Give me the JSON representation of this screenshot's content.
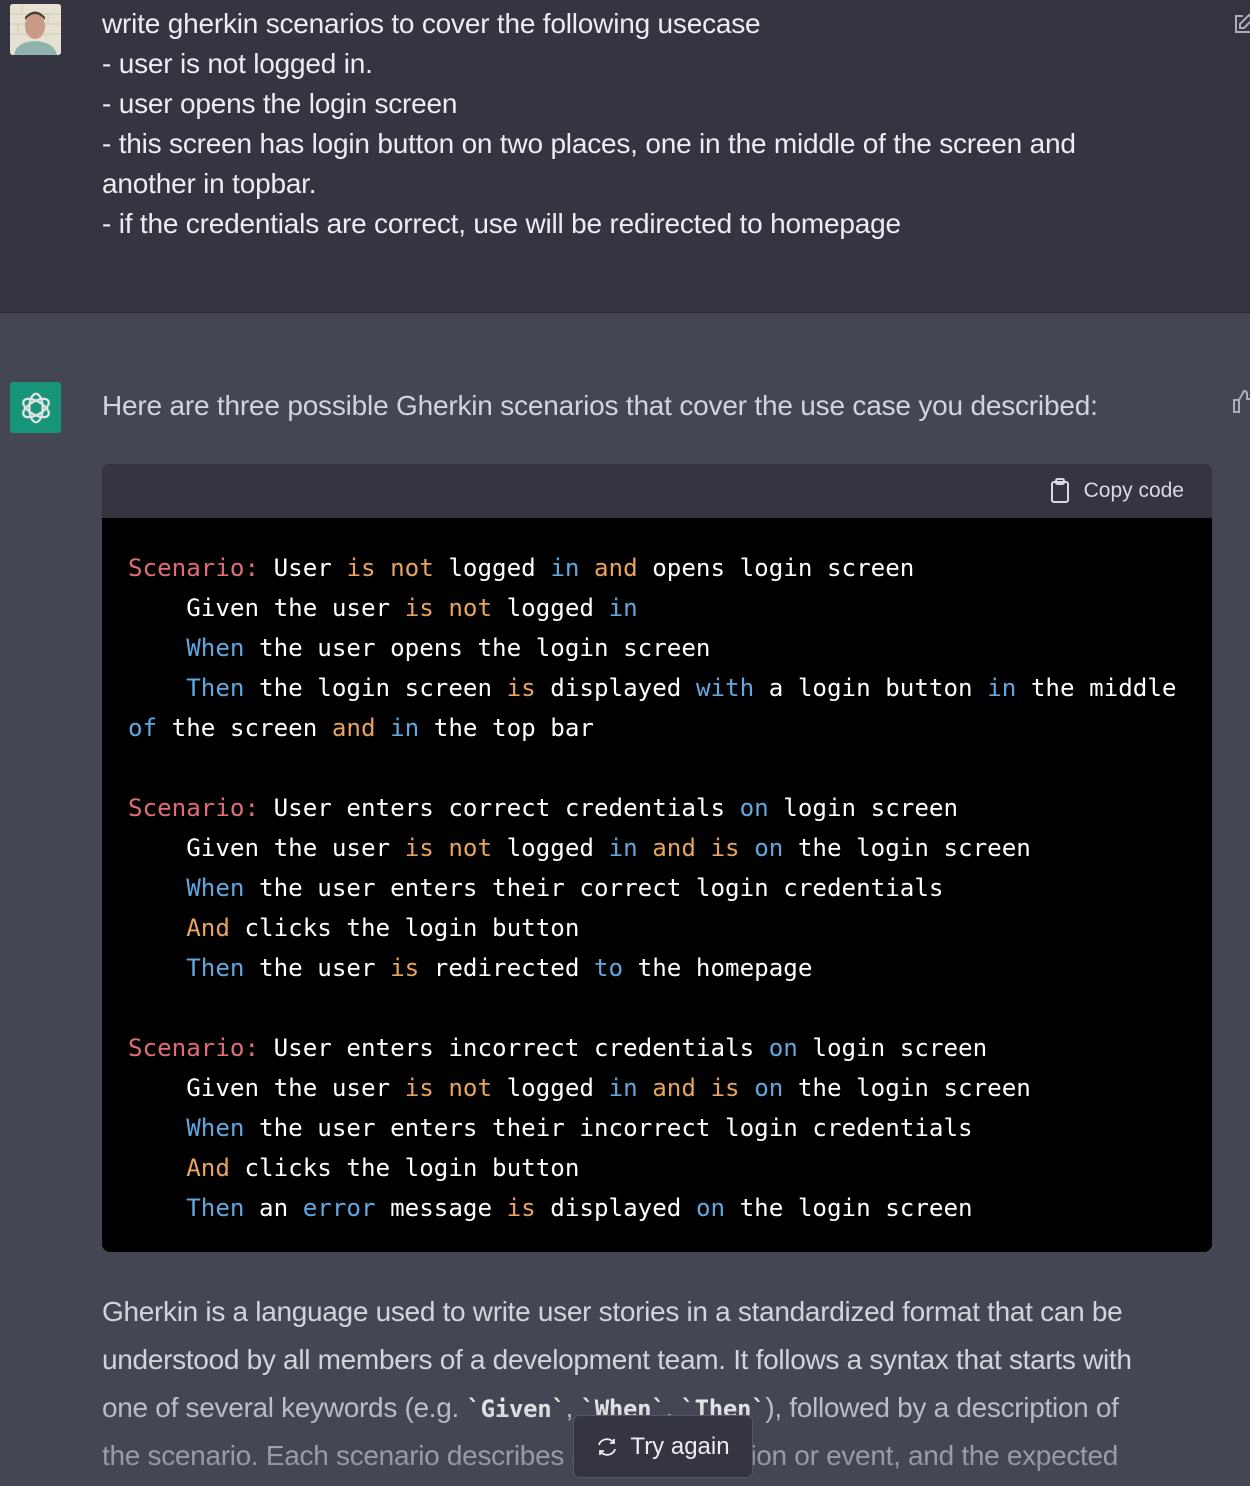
{
  "user_turn": {
    "avatar": "user-avatar-photo",
    "message_lines": [
      "write gherkin scenarios to cover the following usecase",
      "- user is not logged in.",
      "- user opens the login screen",
      "- this screen has login button on two places, one in the middle of the screen and",
      "another in topbar.",
      "- if the credentials are correct, use will be redirected to homepage"
    ],
    "edit_icon": "edit-icon"
  },
  "assistant_turn": {
    "avatar": "openai-logo",
    "intro": "Here are three possible Gherkin scenarios that cover the use case you described:",
    "feedback_icon": "thumbs-up-icon",
    "code_block": {
      "copy_label": "Copy code",
      "copy_icon": "clipboard-icon",
      "lines": [
        [
          [
            "scn",
            "Scenario:"
          ],
          [
            "w",
            " User "
          ],
          [
            "or",
            "is not"
          ],
          [
            "w",
            " logged "
          ],
          [
            "bl",
            "in"
          ],
          [
            "w",
            " "
          ],
          [
            "or",
            "and"
          ],
          [
            "w",
            " opens login screen"
          ]
        ],
        [
          [
            "w",
            "    Given the user "
          ],
          [
            "or",
            "is not"
          ],
          [
            "w",
            " logged "
          ],
          [
            "bl",
            "in"
          ]
        ],
        [
          [
            "w",
            "    "
          ],
          [
            "bl",
            "When"
          ],
          [
            "w",
            " the user opens the login screen"
          ]
        ],
        [
          [
            "w",
            "    "
          ],
          [
            "bl",
            "Then"
          ],
          [
            "w",
            " the login screen "
          ],
          [
            "or",
            "is"
          ],
          [
            "w",
            " displayed "
          ],
          [
            "bl",
            "with"
          ],
          [
            "w",
            " a login button "
          ],
          [
            "bl",
            "in"
          ],
          [
            "w",
            " the middle"
          ]
        ],
        [
          [
            "bl",
            "of"
          ],
          [
            "w",
            " the screen "
          ],
          [
            "or",
            "and"
          ],
          [
            "w",
            " "
          ],
          [
            "bl",
            "in"
          ],
          [
            "w",
            " the top bar"
          ]
        ],
        [
          [
            "w",
            ""
          ]
        ],
        [
          [
            "scn",
            "Scenario:"
          ],
          [
            "w",
            " User enters correct credentials "
          ],
          [
            "bl",
            "on"
          ],
          [
            "w",
            " login screen"
          ]
        ],
        [
          [
            "w",
            "    Given the user "
          ],
          [
            "or",
            "is not"
          ],
          [
            "w",
            " logged "
          ],
          [
            "bl",
            "in"
          ],
          [
            "w",
            " "
          ],
          [
            "or",
            "and is"
          ],
          [
            "w",
            " "
          ],
          [
            "bl",
            "on"
          ],
          [
            "w",
            " the login screen"
          ]
        ],
        [
          [
            "w",
            "    "
          ],
          [
            "bl",
            "When"
          ],
          [
            "w",
            " the user enters their correct login credentials"
          ]
        ],
        [
          [
            "w",
            "    "
          ],
          [
            "or",
            "And"
          ],
          [
            "w",
            " clicks the login button"
          ]
        ],
        [
          [
            "w",
            "    "
          ],
          [
            "bl",
            "Then"
          ],
          [
            "w",
            " the user "
          ],
          [
            "or",
            "is"
          ],
          [
            "w",
            " redirected "
          ],
          [
            "bl",
            "to"
          ],
          [
            "w",
            " the homepage"
          ]
        ],
        [
          [
            "w",
            ""
          ]
        ],
        [
          [
            "scn",
            "Scenario:"
          ],
          [
            "w",
            " User enters incorrect credentials "
          ],
          [
            "bl",
            "on"
          ],
          [
            "w",
            " login screen"
          ]
        ],
        [
          [
            "w",
            "    Given the user "
          ],
          [
            "or",
            "is not"
          ],
          [
            "w",
            " logged "
          ],
          [
            "bl",
            "in"
          ],
          [
            "w",
            " "
          ],
          [
            "or",
            "and is"
          ],
          [
            "w",
            " "
          ],
          [
            "bl",
            "on"
          ],
          [
            "w",
            " the login screen"
          ]
        ],
        [
          [
            "w",
            "    "
          ],
          [
            "bl",
            "When"
          ],
          [
            "w",
            " the user enters their incorrect login credentials"
          ]
        ],
        [
          [
            "w",
            "    "
          ],
          [
            "or",
            "And"
          ],
          [
            "w",
            " clicks the login button"
          ]
        ],
        [
          [
            "w",
            "    "
          ],
          [
            "bl",
            "Then"
          ],
          [
            "w",
            " an "
          ],
          [
            "bl",
            "error"
          ],
          [
            "w",
            " message "
          ],
          [
            "or",
            "is"
          ],
          [
            "w",
            " displayed "
          ],
          [
            "bl",
            "on"
          ],
          [
            "w",
            " the login screen"
          ]
        ]
      ]
    },
    "description_lines": [
      [
        [
          "t",
          "Gherkin is a language used to write user stories in a standardized format that can be"
        ]
      ],
      [
        [
          "t",
          "understood by all members of a development team. It follows a syntax that starts with"
        ]
      ],
      [
        [
          "t",
          "one of several keywords (e.g. "
        ],
        [
          "c",
          "`Given`"
        ],
        [
          "t",
          ", "
        ],
        [
          "c",
          "`When`"
        ],
        [
          "t",
          ", "
        ],
        [
          "c",
          "`Then`"
        ],
        [
          "t",
          "), followed by a description of"
        ]
      ],
      [
        [
          "t",
          "the scenario. Each scenario describes a particular action or event, and the expected"
        ]
      ]
    ],
    "try_again_label": "Try again",
    "try_again_icon": "refresh-icon"
  },
  "colors": {
    "user_bg": "#343541",
    "assistant_bg": "#444654",
    "code_bg": "#000000",
    "code_header_bg": "#343541",
    "keyword_red": "#e06c75",
    "keyword_orange": "#e9a35c",
    "keyword_blue": "#61a8e0",
    "brand_green": "#10a37f"
  }
}
